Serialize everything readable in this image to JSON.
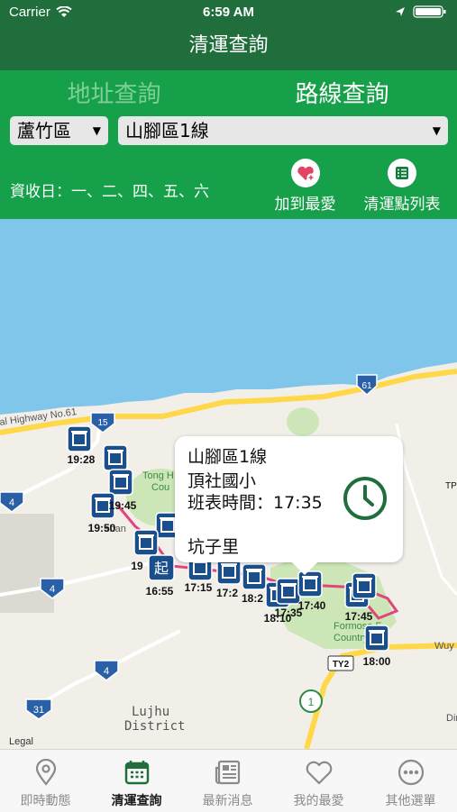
{
  "status_bar": {
    "carrier": "Carrier",
    "time": "6:59 AM"
  },
  "nav": {
    "title": "清運查詢"
  },
  "segments": {
    "address": "地址查詢",
    "route": "路線查詢",
    "selected": "route"
  },
  "filters": {
    "district": "蘆竹區",
    "route": "山腳區1線"
  },
  "recycle_days": "資收日：一、二、四、五、六",
  "actions": {
    "favorite": "加到最愛",
    "point_list": "清運點列表"
  },
  "map": {
    "road_labels": {
      "highway": "al Highway No.61",
      "lujhu": "Lujhu",
      "district": "District",
      "legal": "Legal",
      "tong": "Tong H",
      "cou": "Cou",
      "formosa": "Formosa F",
      "country": "Country Cl",
      "wuy": "Wuy",
      "dim": "Dim",
      "tp": "TP",
      "shan": "shan"
    },
    "route_shields": {
      "r61": "61",
      "r15": "15",
      "r4a": "4",
      "r4b": "4",
      "r4c": "4",
      "r31": "31",
      "ty2": "TY2",
      "r1": "1"
    },
    "stop_times": {
      "t1": "19:28",
      "t2": "19:45",
      "t3": "19:50",
      "t4": "19",
      "t5": "16:55",
      "t6": "17:15",
      "t7": "17:2",
      "t8": "18:2",
      "t9": "18:10",
      "t10": "17:35",
      "t11": "17:40",
      "t12": "17:45",
      "t13": "18:00"
    },
    "start_marker": "起"
  },
  "callout": {
    "route": "山腳區1線",
    "stop": "頂社國小",
    "schedule": "班表時間：17:35",
    "village": "坑子里"
  },
  "tabs": [
    {
      "label": "即時動態",
      "icon": "location-pin-icon"
    },
    {
      "label": "清運查詢",
      "icon": "calendar-icon"
    },
    {
      "label": "最新消息",
      "icon": "news-icon"
    },
    {
      "label": "我的最愛",
      "icon": "heart-icon"
    },
    {
      "label": "其他選單",
      "icon": "more-icon"
    }
  ],
  "colors": {
    "header": "#1f6e3c",
    "panel": "#16a049",
    "route_line": "#e0457b",
    "marker": "#1b4f8c"
  }
}
